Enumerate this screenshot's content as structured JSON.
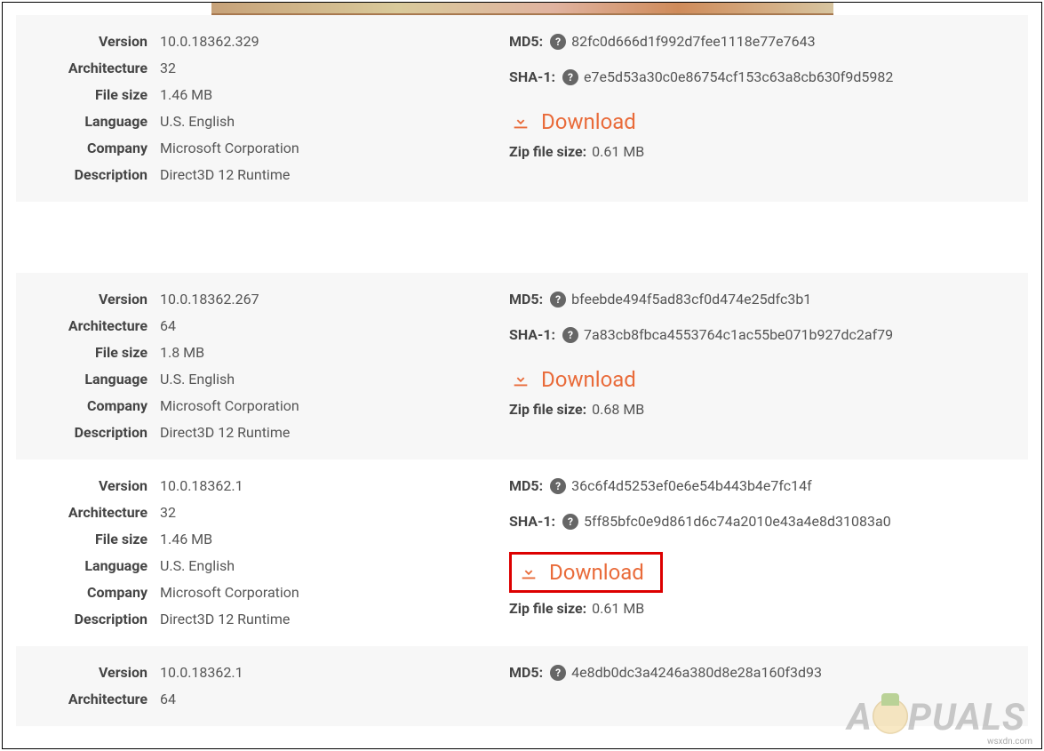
{
  "labels": {
    "version": "Version",
    "architecture": "Architecture",
    "file_size": "File size",
    "language": "Language",
    "company": "Company",
    "description": "Description",
    "md5": "MD5:",
    "sha1": "SHA-1:",
    "download": "Download",
    "zip_size": "Zip file size:"
  },
  "entries": [
    {
      "version": "10.0.18362.329",
      "architecture": "32",
      "file_size": "1.46 MB",
      "language": "U.S. English",
      "company": "Microsoft Corporation",
      "description": "Direct3D 12 Runtime",
      "md5": "82fc0d666d1f992d7fee1118e77e7643",
      "sha1": "e7e5d53a30c0e86754cf153c63a8cb630f9d5982",
      "zip_size": "0.61 MB"
    },
    {
      "version": "10.0.18362.267",
      "architecture": "64",
      "file_size": "1.8 MB",
      "language": "U.S. English",
      "company": "Microsoft Corporation",
      "description": "Direct3D 12 Runtime",
      "md5": "bfeebde494f5ad83cf0d474e25dfc3b1",
      "sha1": "7a83cb8fbca4553764c1ac55be071b927dc2af79",
      "zip_size": "0.68 MB"
    },
    {
      "version": "10.0.18362.1",
      "architecture": "32",
      "file_size": "1.46 MB",
      "language": "U.S. English",
      "company": "Microsoft Corporation",
      "description": "Direct3D 12 Runtime",
      "md5": "36c6f4d5253ef0e6e54b443b4e7fc14f",
      "sha1": "5ff85bfc0e9d861d6c74a2010e43a4e8d31083a0",
      "zip_size": "0.61 MB"
    },
    {
      "version": "10.0.18362.1",
      "architecture": "64",
      "md5": "4e8db0dc3a4246a380d8e28a160f3d93"
    }
  ],
  "watermark_text": "APPUALS",
  "source_caption": "wsxdn.com"
}
